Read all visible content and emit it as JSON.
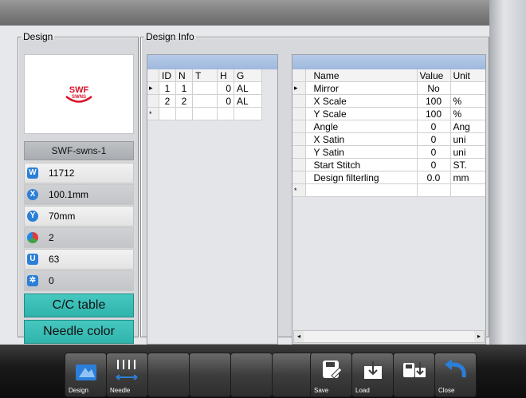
{
  "design_panel": {
    "legend": "Design",
    "logo_text": "SWF",
    "logo_subtext": "SWNS",
    "name": "SWF-swns-1",
    "info": [
      {
        "icon": "stitch-count-icon",
        "value": "11712"
      },
      {
        "icon": "x-dimension-icon",
        "value": "100.1mm"
      },
      {
        "icon": "y-dimension-icon",
        "value": "70mm"
      },
      {
        "icon": "color-count-icon",
        "value": "2"
      },
      {
        "icon": "change-count-icon",
        "value": "63"
      },
      {
        "icon": "settings-icon",
        "value": "0"
      }
    ],
    "cc_table_label": "C/C table",
    "needle_color_label": "Needle color"
  },
  "info_panel": {
    "legend": "Design Info",
    "needle_table": {
      "columns": [
        "ID",
        "N",
        "T",
        "H",
        "G"
      ],
      "rows": [
        [
          "1",
          "1",
          "",
          "0",
          "AL"
        ],
        [
          "2",
          "2",
          "",
          "0",
          "AL"
        ]
      ],
      "new_row_marker": "*",
      "current_row_marker": "▸"
    },
    "param_table": {
      "columns": [
        "Name",
        "Value",
        "Unit"
      ],
      "rows": [
        [
          "Mirror",
          "No",
          ""
        ],
        [
          "X Scale",
          "100",
          "%"
        ],
        [
          "Y Scale",
          "100",
          "%"
        ],
        [
          "Angle",
          "0",
          "Ang"
        ],
        [
          "X Satin",
          "0",
          "uni"
        ],
        [
          "Y Satin",
          "0",
          "uni"
        ],
        [
          "Start Stitch",
          "0",
          "ST."
        ],
        [
          "Design filterling",
          "0.0",
          "mm"
        ]
      ],
      "new_row_marker": "*",
      "current_row_marker": "▸",
      "scroll_left": "◂",
      "scroll_right": "▸"
    }
  },
  "toolbar": {
    "design": "Design",
    "needle": "Needle",
    "save": "Save",
    "load": "Load",
    "close": "Close"
  },
  "colors": {
    "teal_button": "#2fb3ab",
    "table_header": "#9eb8dd",
    "logo_red": "#d8132a",
    "icon_blue": "#2b7fd8"
  }
}
